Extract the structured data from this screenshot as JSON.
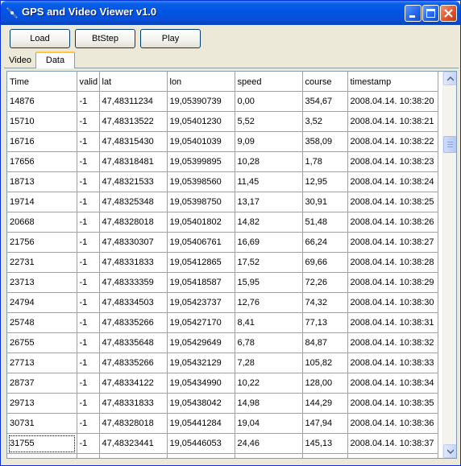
{
  "window": {
    "title": "GPS and Video Viewer v1.0"
  },
  "toolbar": {
    "load_label": "Load",
    "step_label": "BtStep",
    "play_label": "Play"
  },
  "tabs": [
    {
      "label": "Video"
    },
    {
      "label": "Data"
    }
  ],
  "grid": {
    "columns": [
      "Time",
      "valid",
      "lat",
      "lon",
      "speed",
      "course",
      "timestamp"
    ],
    "rows": [
      [
        "14876",
        "-1",
        "47,48311234",
        "19,05390739",
        "0,00",
        "354,67",
        "2008.04.14. 10:38:20"
      ],
      [
        "15710",
        "-1",
        "47,48313522",
        "19,05401230",
        "5,52",
        "3,52",
        "2008.04.14. 10:38:21"
      ],
      [
        "16716",
        "-1",
        "47,48315430",
        "19,05401039",
        "9,09",
        "358,09",
        "2008.04.14. 10:38:22"
      ],
      [
        "17656",
        "-1",
        "47,48318481",
        "19,05399895",
        "10,28",
        "1,78",
        "2008.04.14. 10:38:23"
      ],
      [
        "18713",
        "-1",
        "47,48321533",
        "19,05398560",
        "11,45",
        "12,95",
        "2008.04.14. 10:38:24"
      ],
      [
        "19714",
        "-1",
        "47,48325348",
        "19,05398750",
        "13,17",
        "30,91",
        "2008.04.14. 10:38:25"
      ],
      [
        "20668",
        "-1",
        "47,48328018",
        "19,05401802",
        "14,82",
        "51,48",
        "2008.04.14. 10:38:26"
      ],
      [
        "21756",
        "-1",
        "47,48330307",
        "19,05406761",
        "16,69",
        "66,24",
        "2008.04.14. 10:38:27"
      ],
      [
        "22731",
        "-1",
        "47,48331833",
        "19,05412865",
        "17,52",
        "69,66",
        "2008.04.14. 10:38:28"
      ],
      [
        "23713",
        "-1",
        "47,48333359",
        "19,05418587",
        "15,95",
        "72,26",
        "2008.04.14. 10:38:29"
      ],
      [
        "24794",
        "-1",
        "47,48334503",
        "19,05423737",
        "12,76",
        "74,32",
        "2008.04.14. 10:38:30"
      ],
      [
        "25748",
        "-1",
        "47,48335266",
        "19,05427170",
        "8,41",
        "77,13",
        "2008.04.14. 10:38:31"
      ],
      [
        "26755",
        "-1",
        "47,48335648",
        "19,05429649",
        "6,78",
        "84,87",
        "2008.04.14. 10:38:32"
      ],
      [
        "27713",
        "-1",
        "47,48335266",
        "19,05432129",
        "7,28",
        "105,82",
        "2008.04.14. 10:38:33"
      ],
      [
        "28737",
        "-1",
        "47,48334122",
        "19,05434990",
        "10,22",
        "128,00",
        "2008.04.14. 10:38:34"
      ],
      [
        "29713",
        "-1",
        "47,48331833",
        "19,05438042",
        "14,98",
        "144,29",
        "2008.04.14. 10:38:35"
      ],
      [
        "30731",
        "-1",
        "47,48328018",
        "19,05441284",
        "19,04",
        "147,94",
        "2008.04.14. 10:38:36"
      ],
      [
        "31755",
        "-1",
        "47,48323441",
        "19,05446053",
        "24,46",
        "145,13",
        "2008.04.14. 10:38:37"
      ]
    ],
    "selected_row": 17
  },
  "colors": {
    "titlebar": "#0054e3",
    "window_bg": "#ece9d8",
    "tab_accent": "#ffc83c"
  },
  "icons": {
    "app": "satellite-icon",
    "minimize": "minimize-icon",
    "maximize": "maximize-icon",
    "close": "close-icon"
  }
}
